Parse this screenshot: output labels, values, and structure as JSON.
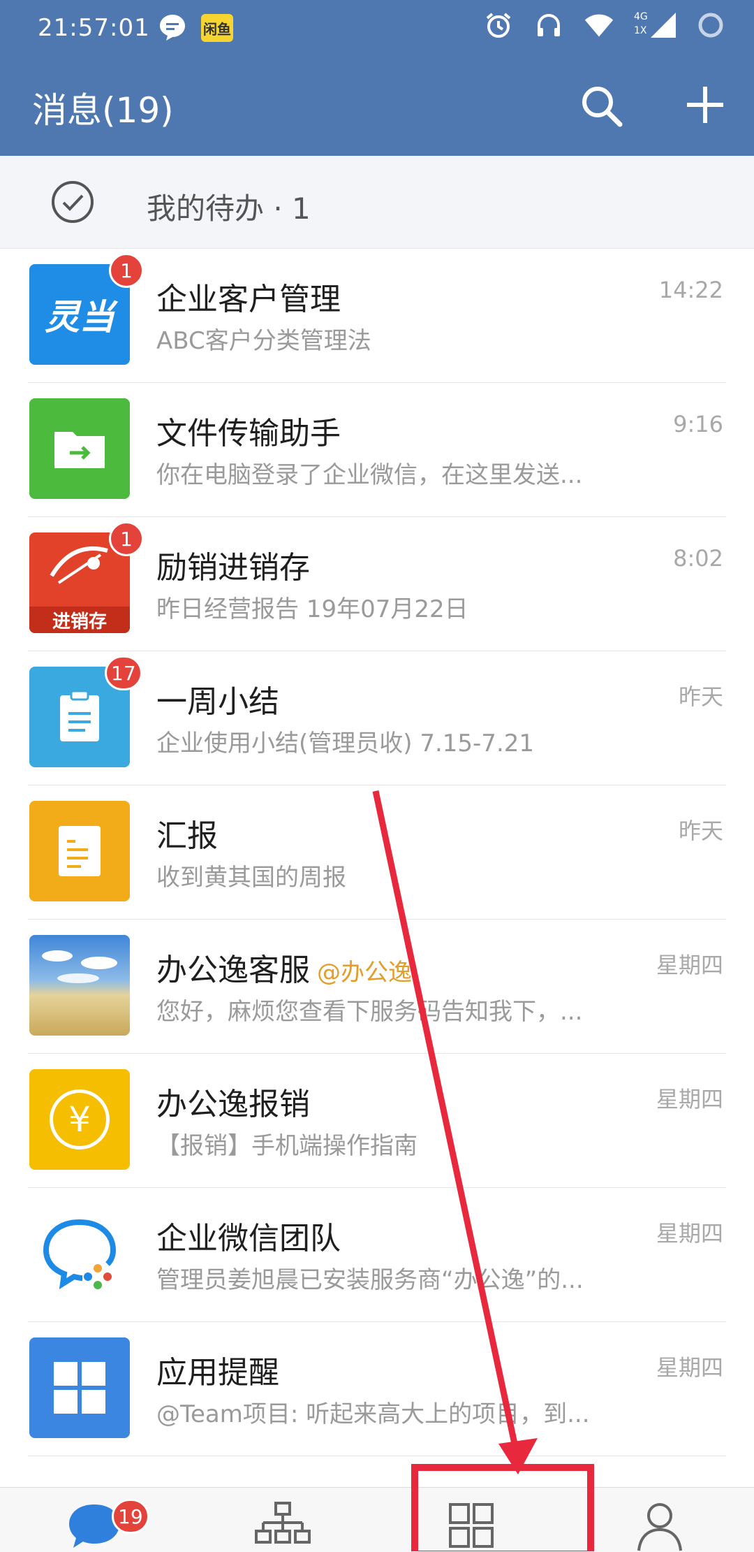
{
  "status_bar": {
    "time": "21:57:01",
    "network": "4G",
    "network_sub": "1X"
  },
  "header": {
    "title": "消息(19)"
  },
  "todo": {
    "label": "我的待办 · 1"
  },
  "messages": [
    {
      "name": "企业客户管理",
      "preview": "ABC客户分类管理法",
      "time": "14:22",
      "badge": "1",
      "avatar_text": "灵当"
    },
    {
      "name": "文件传输助手",
      "preview": "你在电脑登录了企业微信，在这里发送...",
      "time": "9:16",
      "badge": ""
    },
    {
      "name": "励销进销存",
      "preview": "昨日经营报告 19年07月22日",
      "time": "8:02",
      "badge": "1",
      "avatar_text": "进销存"
    },
    {
      "name": "一周小结",
      "preview": "企业使用小结(管理员收) 7.15-7.21",
      "time": "昨天",
      "badge": "17"
    },
    {
      "name": "汇报",
      "preview": "收到黄其国的周报",
      "time": "昨天",
      "badge": ""
    },
    {
      "name": "办公逸客服",
      "at": "@办公逸",
      "preview": "您好，麻烦您查看下服务码告知我下，...",
      "time": "星期四",
      "badge": ""
    },
    {
      "name": "办公逸报销",
      "preview": "【报销】手机端操作指南",
      "time": "星期四",
      "badge": "",
      "avatar_text": "¥"
    },
    {
      "name": "企业微信团队",
      "preview": "管理员姜旭晨已安装服务商“办公逸”的...",
      "time": "星期四",
      "badge": ""
    },
    {
      "name": "应用提醒",
      "preview": "@Team项目: 听起来高大上的项目，到...",
      "time": "星期四",
      "badge": ""
    }
  ],
  "bottom_nav": {
    "messages_badge": "19"
  },
  "colors": {
    "header": "#4f78b0",
    "badge": "#e3433b",
    "annotation": "#e8283c"
  }
}
